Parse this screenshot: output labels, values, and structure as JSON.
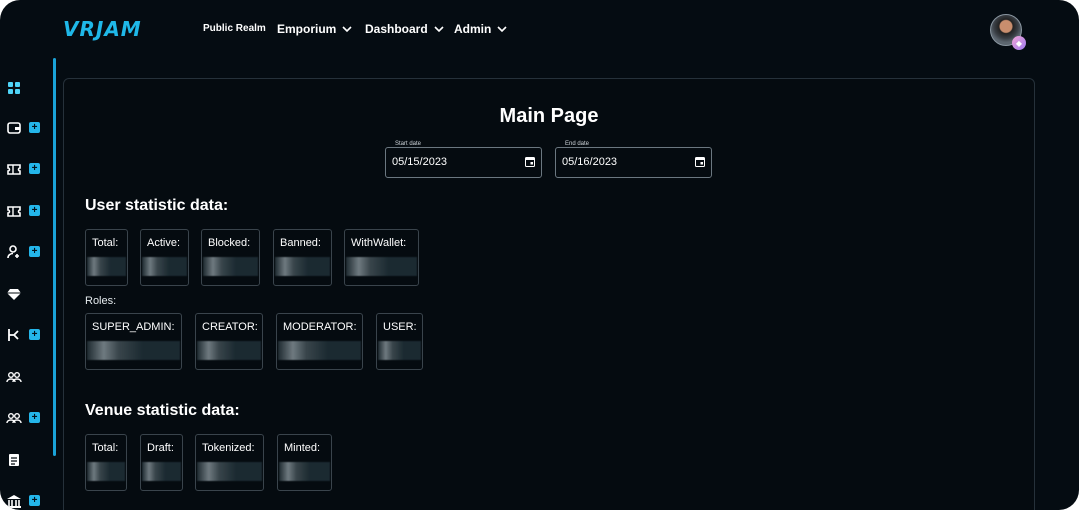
{
  "app": {
    "logo_text": "VRJAM"
  },
  "nav": {
    "items": [
      {
        "label": "Public Realm",
        "has_dropdown": false
      },
      {
        "label": "Emporium",
        "has_dropdown": true
      },
      {
        "label": "Dashboard",
        "has_dropdown": true
      },
      {
        "label": "Admin",
        "has_dropdown": true
      }
    ]
  },
  "user": {
    "avatar": "avatar-image",
    "badge_icon": "gem-icon"
  },
  "sidebar": {
    "items": [
      {
        "icon": "grid-icon",
        "has_plus": false
      },
      {
        "icon": "wallet-icon",
        "has_plus": true
      },
      {
        "icon": "ticket-icon",
        "has_plus": true
      },
      {
        "icon": "ticket-icon",
        "has_plus": true
      },
      {
        "icon": "add-user-icon",
        "has_plus": true
      },
      {
        "icon": "gem-icon",
        "has_plus": false
      },
      {
        "icon": "route-icon",
        "has_plus": true
      },
      {
        "icon": "group-icon",
        "has_plus": false
      },
      {
        "icon": "group-icon",
        "has_plus": true
      },
      {
        "icon": "document-icon",
        "has_plus": false
      },
      {
        "icon": "bank-icon",
        "has_plus": true
      }
    ],
    "plus_label": "+"
  },
  "main": {
    "title": "Main Page",
    "start_date": {
      "label": "Start date",
      "value": "05/15/2023"
    },
    "end_date": {
      "label": "End date",
      "value": "05/16/2023"
    },
    "user_section_title": "User statistic data:",
    "user_stats": [
      "Total:",
      "Active:",
      "Blocked:",
      "Banned:",
      "WithWallet:"
    ],
    "roles_label": "Roles:",
    "role_stats": [
      "SUPER_ADMIN:",
      "CREATOR:",
      "MODERATOR:",
      "USER:"
    ],
    "venue_section_title": "Venue statistic data:",
    "venue_stats": [
      "Total:",
      "Draft:",
      "Tokenized:",
      "Minted:"
    ]
  },
  "colors": {
    "background": "#050c12",
    "accent": "#24b6ea",
    "border": "#3a444c"
  }
}
